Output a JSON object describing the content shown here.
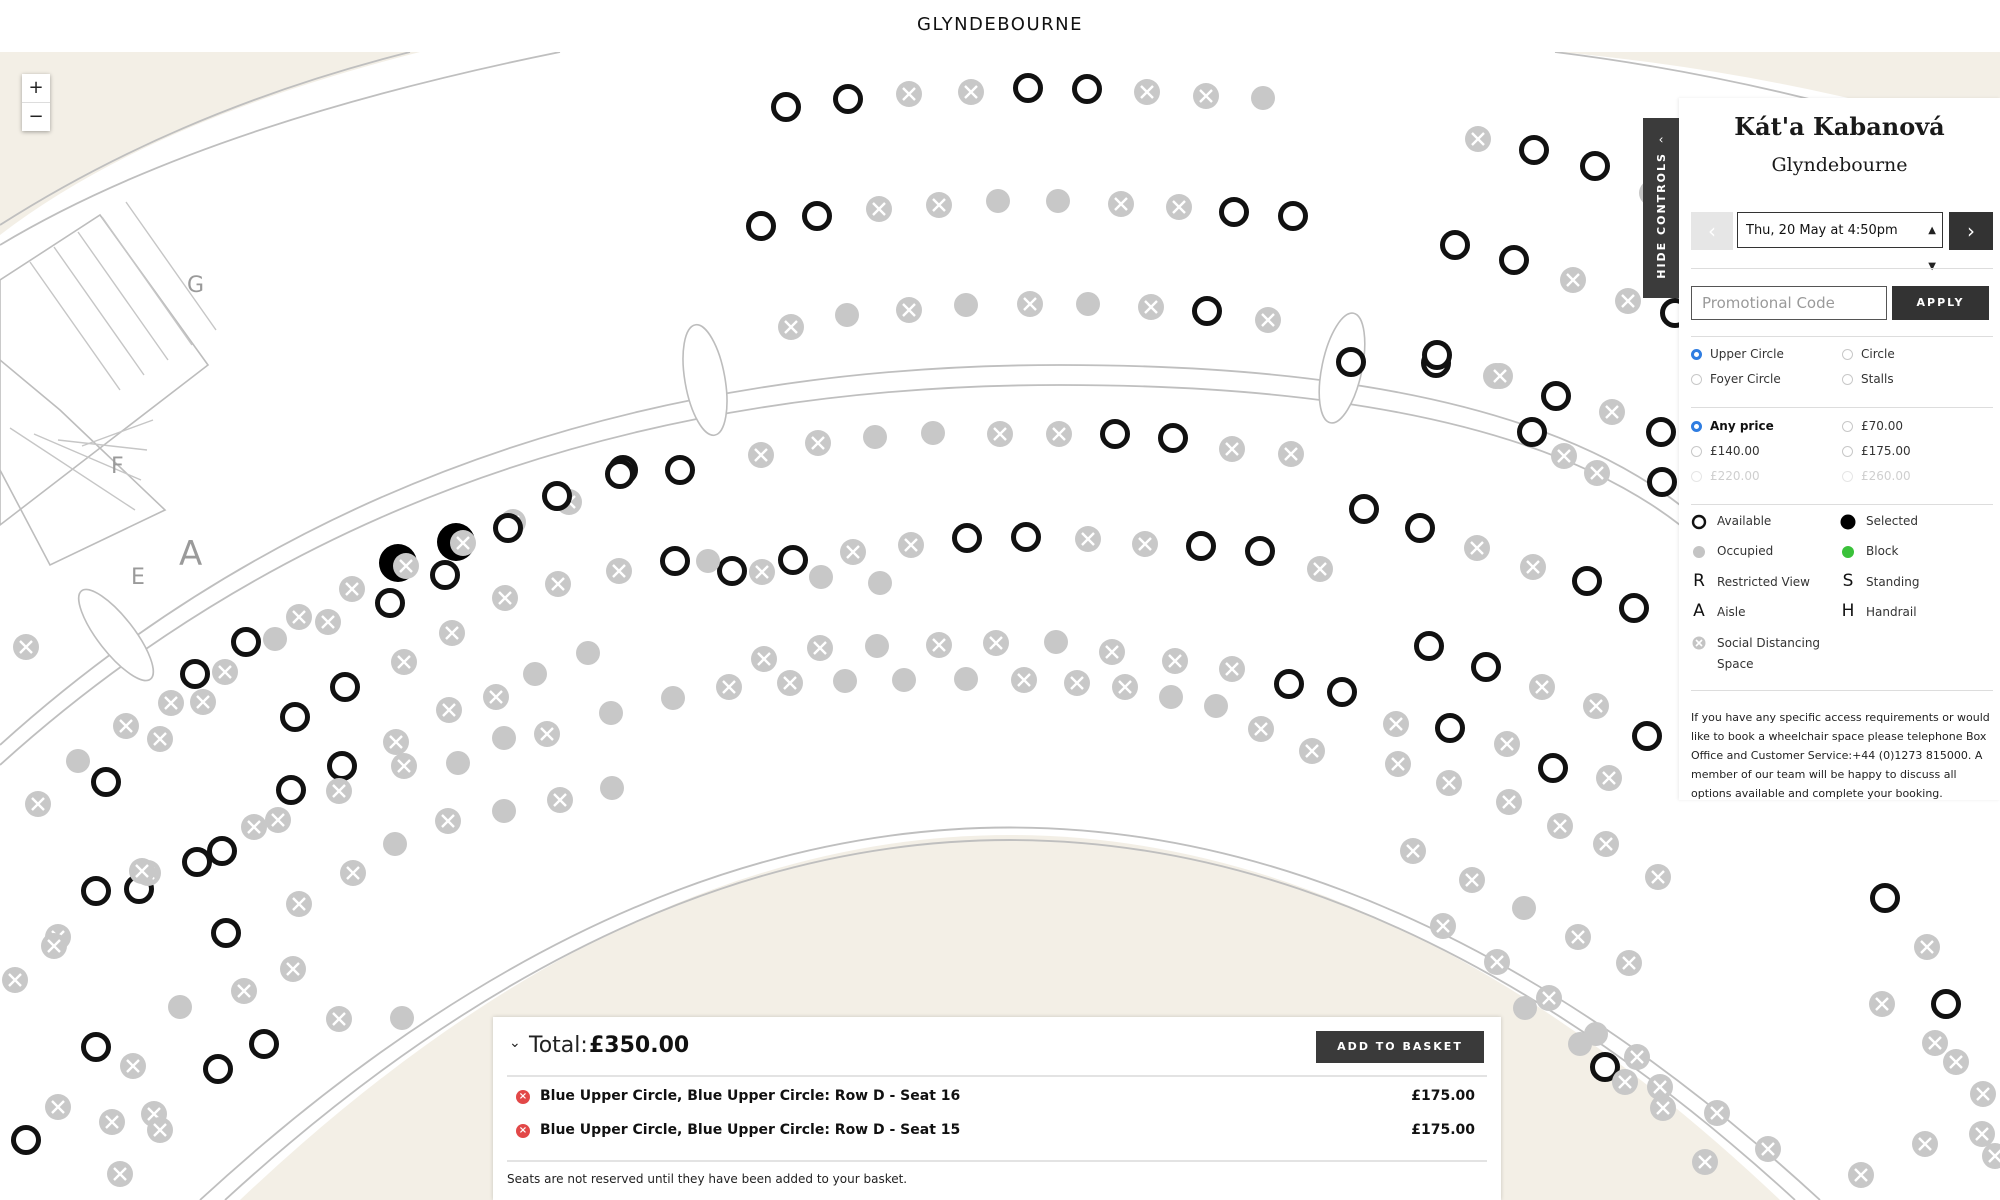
{
  "header": {
    "logo_text": "GLYNDEBOURNE"
  },
  "zoom": {
    "in_label": "+",
    "out_label": "−"
  },
  "map": {
    "row_labels": [
      "G",
      "F",
      "E",
      "A"
    ],
    "status_colors": {
      "available": "#111111",
      "selected": "#000000",
      "occupied": "#c8c8c8",
      "block": "#3ac13a",
      "background": "#f3efe6"
    }
  },
  "controls": {
    "hide_controls_label": "HIDE CONTROLS",
    "title": "Kát'a Kabanová",
    "venue": "Glyndebourne",
    "date_selected": "Thu, 20 May at 4:50pm",
    "prev_icon": "chevron-left-icon",
    "next_icon": "chevron-right-icon",
    "promo_placeholder": "Promotional Code",
    "apply_label": "APPLY",
    "sections": [
      {
        "label": "Upper Circle",
        "checked": true
      },
      {
        "label": "Circle",
        "checked": false
      },
      {
        "label": "Foyer Circle",
        "checked": false
      },
      {
        "label": "Stalls",
        "checked": false
      }
    ],
    "prices": [
      {
        "label": "Any price",
        "checked": true
      },
      {
        "label": "£70.00",
        "checked": false
      },
      {
        "label": "£140.00",
        "checked": false
      },
      {
        "label": "£175.00",
        "checked": false
      },
      {
        "label": "£220.00",
        "checked": false,
        "disabled": true
      },
      {
        "label": "£260.00",
        "checked": false,
        "disabled": true
      }
    ],
    "legend": {
      "available": "Available",
      "selected": "Selected",
      "occupied": "Occupied",
      "block": "Block",
      "restricted_letter": "R",
      "restricted": "Restricted View",
      "standing_letter": "S",
      "standing": "Standing",
      "aisle_letter": "A",
      "aisle": "Aisle",
      "handrail_letter": "H",
      "handrail": "Handrail",
      "social_distancing": "Social Distancing Space"
    },
    "access_note": "If you have any specific access requirements or would like to book a wheelchair space please telephone Box Office and Customer Service:+44 (0)1273 815000. A member of our team will be happy to discuss all options available and complete your booking."
  },
  "basket": {
    "total_label": "Total:",
    "total_value": "£350.00",
    "add_label": "ADD TO BASKET",
    "items": [
      {
        "description": "Blue Upper Circle, Blue Upper Circle: Row D - Seat 16",
        "price": "£175.00"
      },
      {
        "description": "Blue Upper Circle, Blue Upper Circle: Row D - Seat 15",
        "price": "£175.00"
      }
    ],
    "note": "Seats are not reserved until they have been added to your basket."
  }
}
